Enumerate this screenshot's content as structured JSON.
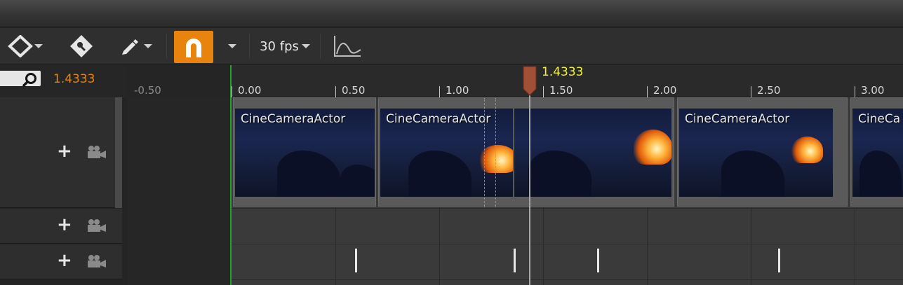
{
  "toolbar": {
    "key_button_icon": "key-diamond-icon",
    "transform_button_icon": "transform-key-icon",
    "edit_button_icon": "pencil-icon",
    "snap_button_icon": "magnet-icon",
    "snap_active_color": "#e8830d",
    "fps_label": "30 fps",
    "curve_editor_icon": "curve-icon"
  },
  "search": {
    "icon": "search-icon",
    "current_time": "1.4333"
  },
  "timeline": {
    "ticks": [
      {
        "label": "-0.50",
        "dim": true
      },
      {
        "label": "0.00"
      },
      {
        "label": "0.50"
      },
      {
        "label": "1.00"
      },
      {
        "label": "1.50"
      },
      {
        "label": "2.00"
      },
      {
        "label": "2.50"
      },
      {
        "label": "3.00"
      }
    ],
    "playhead_label": "1.4333",
    "playhead_time": 1.4333,
    "playhead_color": "#f3f32a",
    "playrange_start_color": "#1fa52b"
  },
  "tracks": [
    {
      "add_icon": "plus-icon",
      "camera_icon": "camera-icon"
    },
    {
      "add_icon": "plus-icon",
      "camera_icon": "camera-icon"
    },
    {
      "add_icon": "plus-icon",
      "camera_icon": "camera-icon"
    }
  ],
  "shots": [
    {
      "label": "CineCameraActor"
    },
    {
      "label": "CineCameraActor"
    },
    {
      "label": "CineCameraActor"
    },
    {
      "label": "CineCa"
    }
  ]
}
